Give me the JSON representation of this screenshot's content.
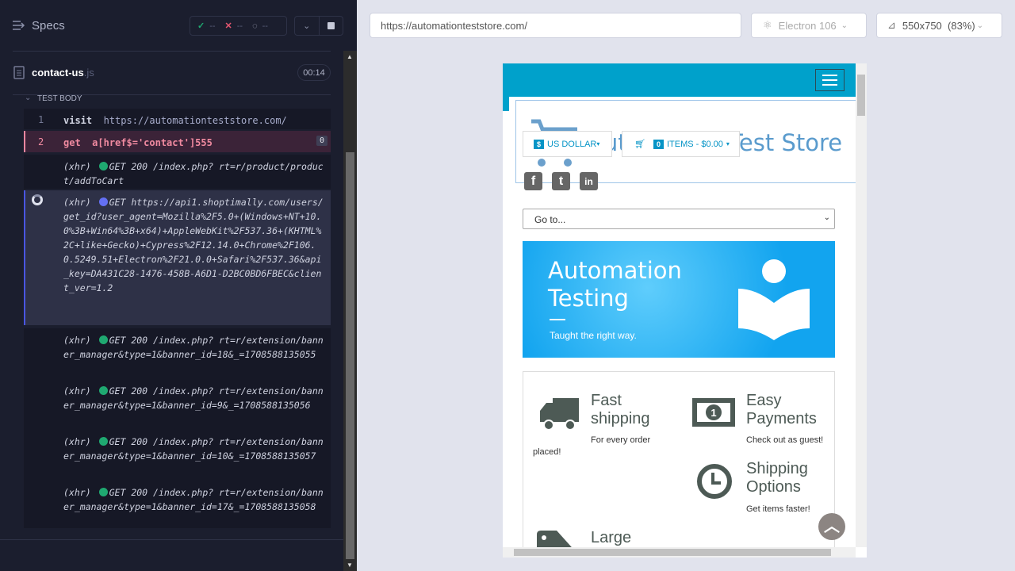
{
  "reporter": {
    "title": "Specs",
    "stats": {
      "passed": "--",
      "failed": "--",
      "pending": "--"
    },
    "spec": {
      "name": "contact-us",
      "ext": ".js",
      "duration": "00:14"
    },
    "section": "TEST BODY",
    "commands": [
      {
        "num": "1",
        "name": "visit",
        "message": "https://automationteststore.com/"
      },
      {
        "num": "2",
        "name": "get",
        "message": "a[href$='contact']555",
        "badge": "0"
      }
    ],
    "xhr": [
      {
        "label": "(xhr)",
        "method": "GET 200",
        "url": "/index.php? rt=r/product/product/addToCart",
        "status": "success"
      },
      {
        "label": "(xhr)",
        "method": "GET",
        "url": "https://api1.shoptimally.com/users/get_id?user_agent=Mozilla%2F5.0+(Windows+NT+10.0%3B+Win64%3B+x64)+AppleWebKit%2F537.36+(KHTML%2C+like+Gecko)+Cypress%2F12.14.0+Chrome%2F106.0.5249.51+Electron%2F21.0.0+Safari%2F537.36&api_key=DA431C28-1476-458B-A6D1-D2BC0BD6FBEC&client_ver=1.2",
        "status": "pending"
      },
      {
        "label": "(xhr)",
        "method": "GET 200",
        "url": "/index.php? rt=r/extension/banner_manager&type=1&banner_id=18&_=1708588135055",
        "status": "success"
      },
      {
        "label": "(xhr)",
        "method": "GET 200",
        "url": "/index.php? rt=r/extension/banner_manager&type=1&banner_id=9&_=1708588135056",
        "status": "success"
      },
      {
        "label": "(xhr)",
        "method": "GET 200",
        "url": "/index.php? rt=r/extension/banner_manager&type=1&banner_id=10&_=1708588135057",
        "status": "success"
      },
      {
        "label": "(xhr)",
        "method": "GET 200",
        "url": "/index.php? rt=r/extension/banner_manager&type=1&banner_id=17&_=1708588135058",
        "status": "success"
      }
    ]
  },
  "aut_bar": {
    "url": "https://automationteststore.com/",
    "browser": "Electron 106",
    "viewport": "550x750",
    "scale": "(83%)"
  },
  "site": {
    "logo_text": "Automation Test Store",
    "currency": "US DOLLAR",
    "currency_symbol": "$",
    "cart_count": "0",
    "cart_label": "ITEMS - $0.00",
    "goto": "Go to...",
    "banner": {
      "title_1": "Automation",
      "title_2": "Testing",
      "subtitle": "Taught the right way."
    },
    "features": [
      {
        "title_1": "Fast",
        "title_2": "shipping",
        "sub_1": "For every order",
        "sub_2": "placed!"
      },
      {
        "title_1": "Easy",
        "title_2": "Payments",
        "sub_1": "Check out as guest!"
      },
      {
        "title_1": "Shipping",
        "title_2": "Options",
        "sub_1": "Get items faster!"
      },
      {
        "title_1": "Large"
      }
    ]
  },
  "colors": {
    "brand": "#00a1cb",
    "failed": "#e45770",
    "passed": "#1fa971",
    "pending": "#6470f3"
  }
}
